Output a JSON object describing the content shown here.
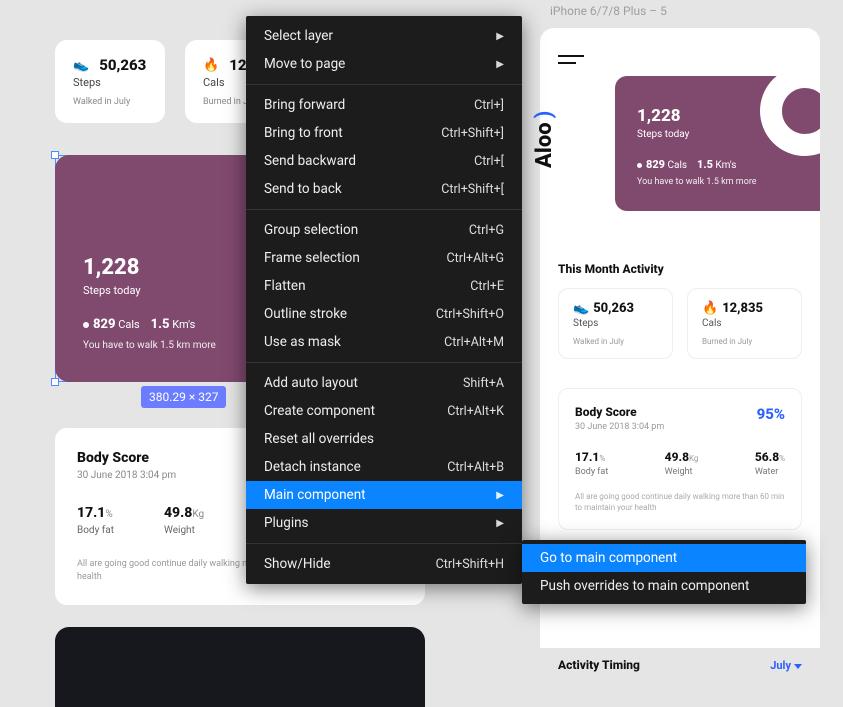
{
  "phone_label": "iPhone 6/7/8 Plus – 5",
  "brand": "Aloo",
  "stats": {
    "steps": {
      "value": "50,263",
      "label": "Steps",
      "sub": "Walked in July"
    },
    "cals": {
      "value": "12,835",
      "label": "Cals",
      "sub": "Burned in July"
    }
  },
  "bigcard": {
    "steps_num": "1,228",
    "steps_label": "Steps today",
    "cals_num": "829",
    "cals_label": "Cals",
    "km_num": "1.5",
    "km_label": "Km's",
    "tip": "You have to walk 1.5 km more"
  },
  "selection_dims": "380.29 × 327",
  "body": {
    "title": "Body Score",
    "date": "30 June 2018 3:04 pm",
    "pct": "95%",
    "fat_v": "17.1",
    "fat_u": "%",
    "fat_l": "Body fat",
    "wt_v": "49.8",
    "wt_u": "Kg",
    "wt_l": "Weight",
    "water_v": "56.8",
    "water_u": "%",
    "water_l": "Water",
    "msg": "All are going good continue daily walking more than 60 min to maintain your health"
  },
  "sections": {
    "month": "This Month Activity",
    "timing": "Activity Timing",
    "month_picker": "July"
  },
  "ctx": {
    "select_layer": "Select layer",
    "move_to_page": "Move to page",
    "bring_forward": "Bring forward",
    "bring_forward_sc": "Ctrl+]",
    "bring_front": "Bring to front",
    "bring_front_sc": "Ctrl+Shift+]",
    "send_backward": "Send backward",
    "send_backward_sc": "Ctrl+[",
    "send_back": "Send to back",
    "send_back_sc": "Ctrl+Shift+[",
    "group": "Group selection",
    "group_sc": "Ctrl+G",
    "frame": "Frame selection",
    "frame_sc": "Ctrl+Alt+G",
    "flatten": "Flatten",
    "flatten_sc": "Ctrl+E",
    "outline": "Outline stroke",
    "outline_sc": "Ctrl+Shift+O",
    "mask": "Use as mask",
    "mask_sc": "Ctrl+Alt+M",
    "autolayout": "Add auto layout",
    "autolayout_sc": "Shift+A",
    "create_comp": "Create component",
    "create_comp_sc": "Ctrl+Alt+K",
    "reset_over": "Reset all overrides",
    "detach": "Detach instance",
    "detach_sc": "Ctrl+Alt+B",
    "main_comp": "Main component",
    "plugins": "Plugins",
    "showhide": "Show/Hide",
    "showhide_sc": "Ctrl+Shift+H"
  },
  "sub": {
    "goto": "Go to main component",
    "push": "Push overrides to main component"
  }
}
